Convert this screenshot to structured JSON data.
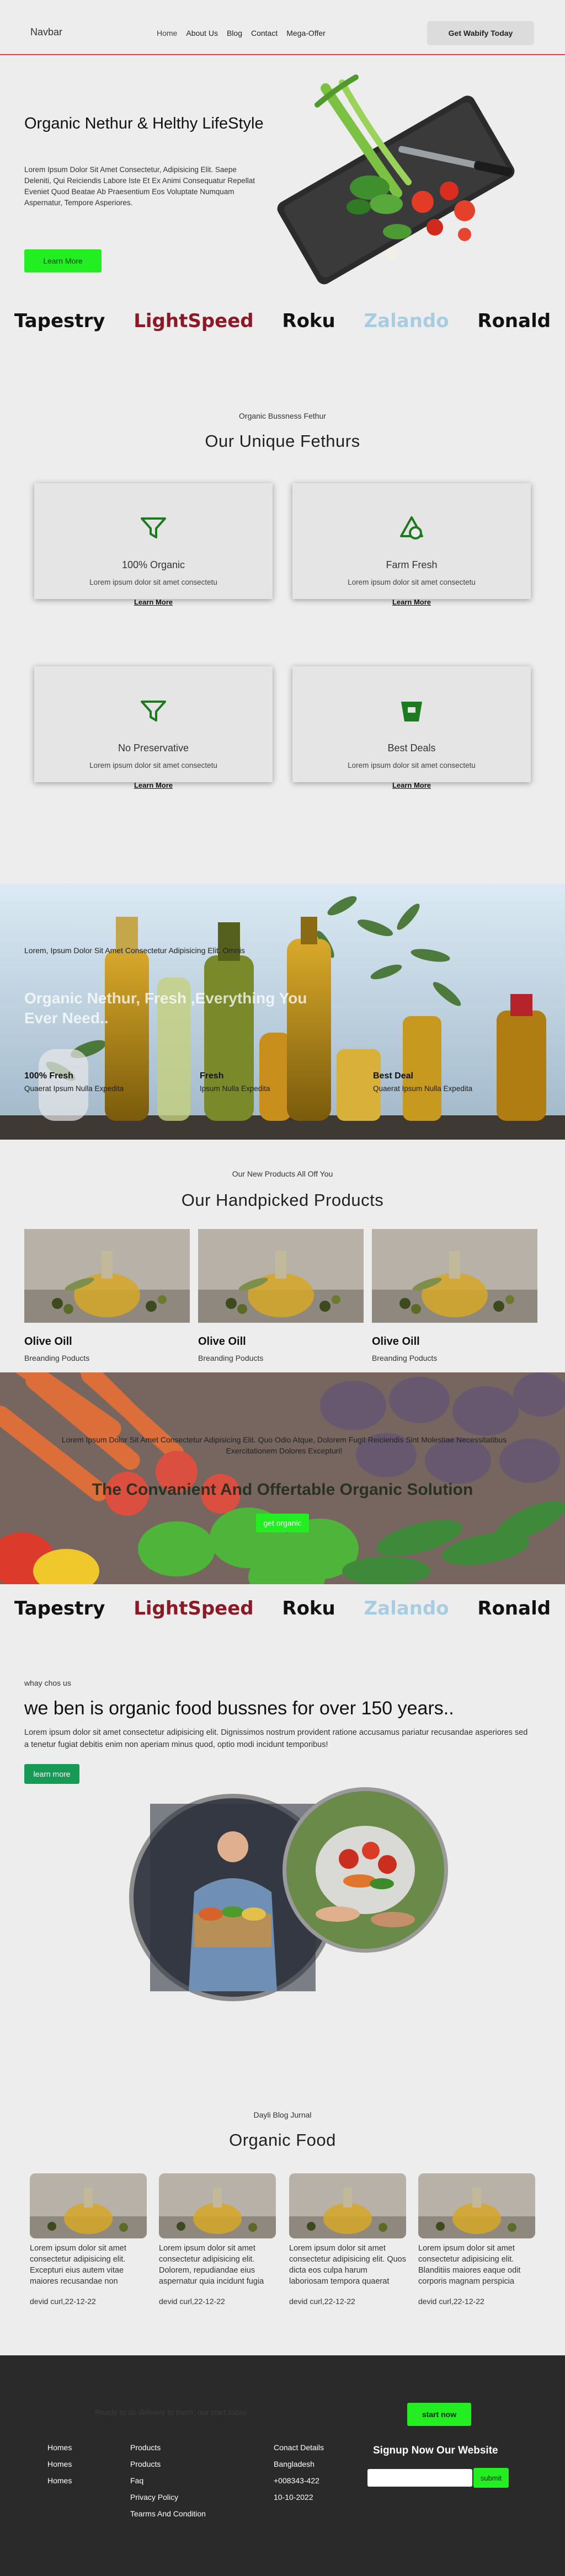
{
  "nav": {
    "brand": "Navbar",
    "links": [
      "Home",
      "About Us",
      "Blog",
      "Contact",
      "Mega-Offer"
    ],
    "cta": "Get Wabify Today"
  },
  "hero": {
    "title": "Organic Nethur & Helthy LifeStyle",
    "text": "Lorem Ipsum Dolor Sit Amet Consectetur, Adipisicing Elit. Saepe Deleniti, Qui Reiciendis Labore Iste Et Ex Animi Consequatur Repellat Eveniet Quod Beatae Ab Praesentium Eos Voluptate Numquam Aspernatur, Tempore Asperiores.",
    "button": "Learn More"
  },
  "brands": [
    "Tapestry",
    "LightSpeed",
    "Roku",
    "Zalando",
    "Ronald"
  ],
  "features": {
    "subtitle": "Organic Bussness Fethur",
    "title": "Our Unique Fethurs",
    "cards": [
      {
        "icon": "funnel-icon",
        "title": "100% Organic",
        "text": "Lorem ipsum dolor sit amet consectetu",
        "link": "Learn More"
      },
      {
        "icon": "shapes-icon",
        "title": "Farm Fresh",
        "text": "Lorem ipsum dolor sit amet consectetu",
        "link": "Learn More"
      },
      {
        "icon": "funnel-icon",
        "title": "No Preservative",
        "text": "Lorem ipsum dolor sit amet consectetu",
        "link": "Learn More"
      },
      {
        "icon": "bucket-icon",
        "title": "Best Deals",
        "text": "Lorem ipsum dolor sit amet consectetu",
        "link": "Learn More"
      }
    ]
  },
  "oil_banner": {
    "small": "Lorem, Ipsum Dolor Sit Amet Consectetur Adipisicing Elit. Omnis",
    "title": "Organic Nethur, Fresh ,Everything You Ever Need..",
    "features": [
      {
        "title": "100% Fresh",
        "text": "Quaerat Ipsum Nulla Expedita"
      },
      {
        "title": "Fresh",
        "text": "Ipsum Nulla Expedita"
      },
      {
        "title": "Best Deal",
        "text": "Quaerat Ipsum Nulla Expedita"
      }
    ]
  },
  "products": {
    "subtitle": "Our New Products All Off You",
    "title": "Our Handpicked Products",
    "items": [
      {
        "name": "Olive Oill",
        "category": "Breanding Poducts"
      },
      {
        "name": "Olive Oill",
        "category": "Breanding Poducts"
      },
      {
        "name": "Olive Oill",
        "category": "Breanding Poducts"
      }
    ]
  },
  "veg_banner": {
    "text": "Lorem Ipsum Dolor Sit Amet Consectetur Adipisicing Elit. Quo Odio Atque, Dolorem Fugit Reiciendis Sint Molestiae Necessitatibus Exercitationem Dolores Excepturi!",
    "title": "The Convanient And Offertable Organic Solution",
    "button": "get organic"
  },
  "why": {
    "small": "whay chos us",
    "title": "we ben is organic food bussnes for over 150 years..",
    "text": "Lorem ipsum dolor sit amet consectetur adipisicing elit. Dignissimos nostrum provident ratione accusamus pariatur recusandae asperiores sed a tenetur fugiat debitis enim non aperiam minus quod, optio modi incidunt temporibus!",
    "button": "learn more"
  },
  "blog": {
    "subtitle": "Dayli Blog Jurnal",
    "title": "Organic Food",
    "posts": [
      {
        "text": "Lorem ipsum dolor sit amet consectetur adipisicing elit. Excepturi eius autem vitae maiores recusandae non",
        "date": "devid curl,22-12-22"
      },
      {
        "text": "Lorem ipsum dolor sit amet consectetur adipisicing elit. Dolorem, repudiandae eius aspernatur quia incidunt fugia",
        "date": "devid curl,22-12-22"
      },
      {
        "text": "Lorem ipsum dolor sit amet consectetur adipisicing elit. Quos dicta eos culpa harum laboriosam tempora quaerat",
        "date": "devid curl,22-12-22"
      },
      {
        "text": "Lorem ipsum dolor sit amet consectetur adipisicing elit. Blanditiis maiores eaque odit corporis magnam perspicia",
        "date": "devid curl,22-12-22"
      }
    ]
  },
  "footer": {
    "hidden_text": "Ready to do delivery to them, our start today",
    "start_button": "start now",
    "col1": [
      "Homes",
      "Homes",
      "Homes"
    ],
    "col2": [
      "Products",
      "Products",
      "Faq",
      "Privacy Policy",
      "Tearms And Condition"
    ],
    "col3": [
      "Conact Details",
      "Bangladesh",
      "+008343-422",
      "10-10-2022"
    ],
    "signup_title": "Signup Now Our Website",
    "email_value": "",
    "submit": "submit"
  },
  "colors": {
    "accent_green": "#22ee22",
    "dark_green": "#189a57",
    "nav_border": "#d8434d",
    "footer_bg": "#2a2a2a",
    "brand_red": "#8b1a26",
    "brand_blue": "#a8cde0"
  }
}
